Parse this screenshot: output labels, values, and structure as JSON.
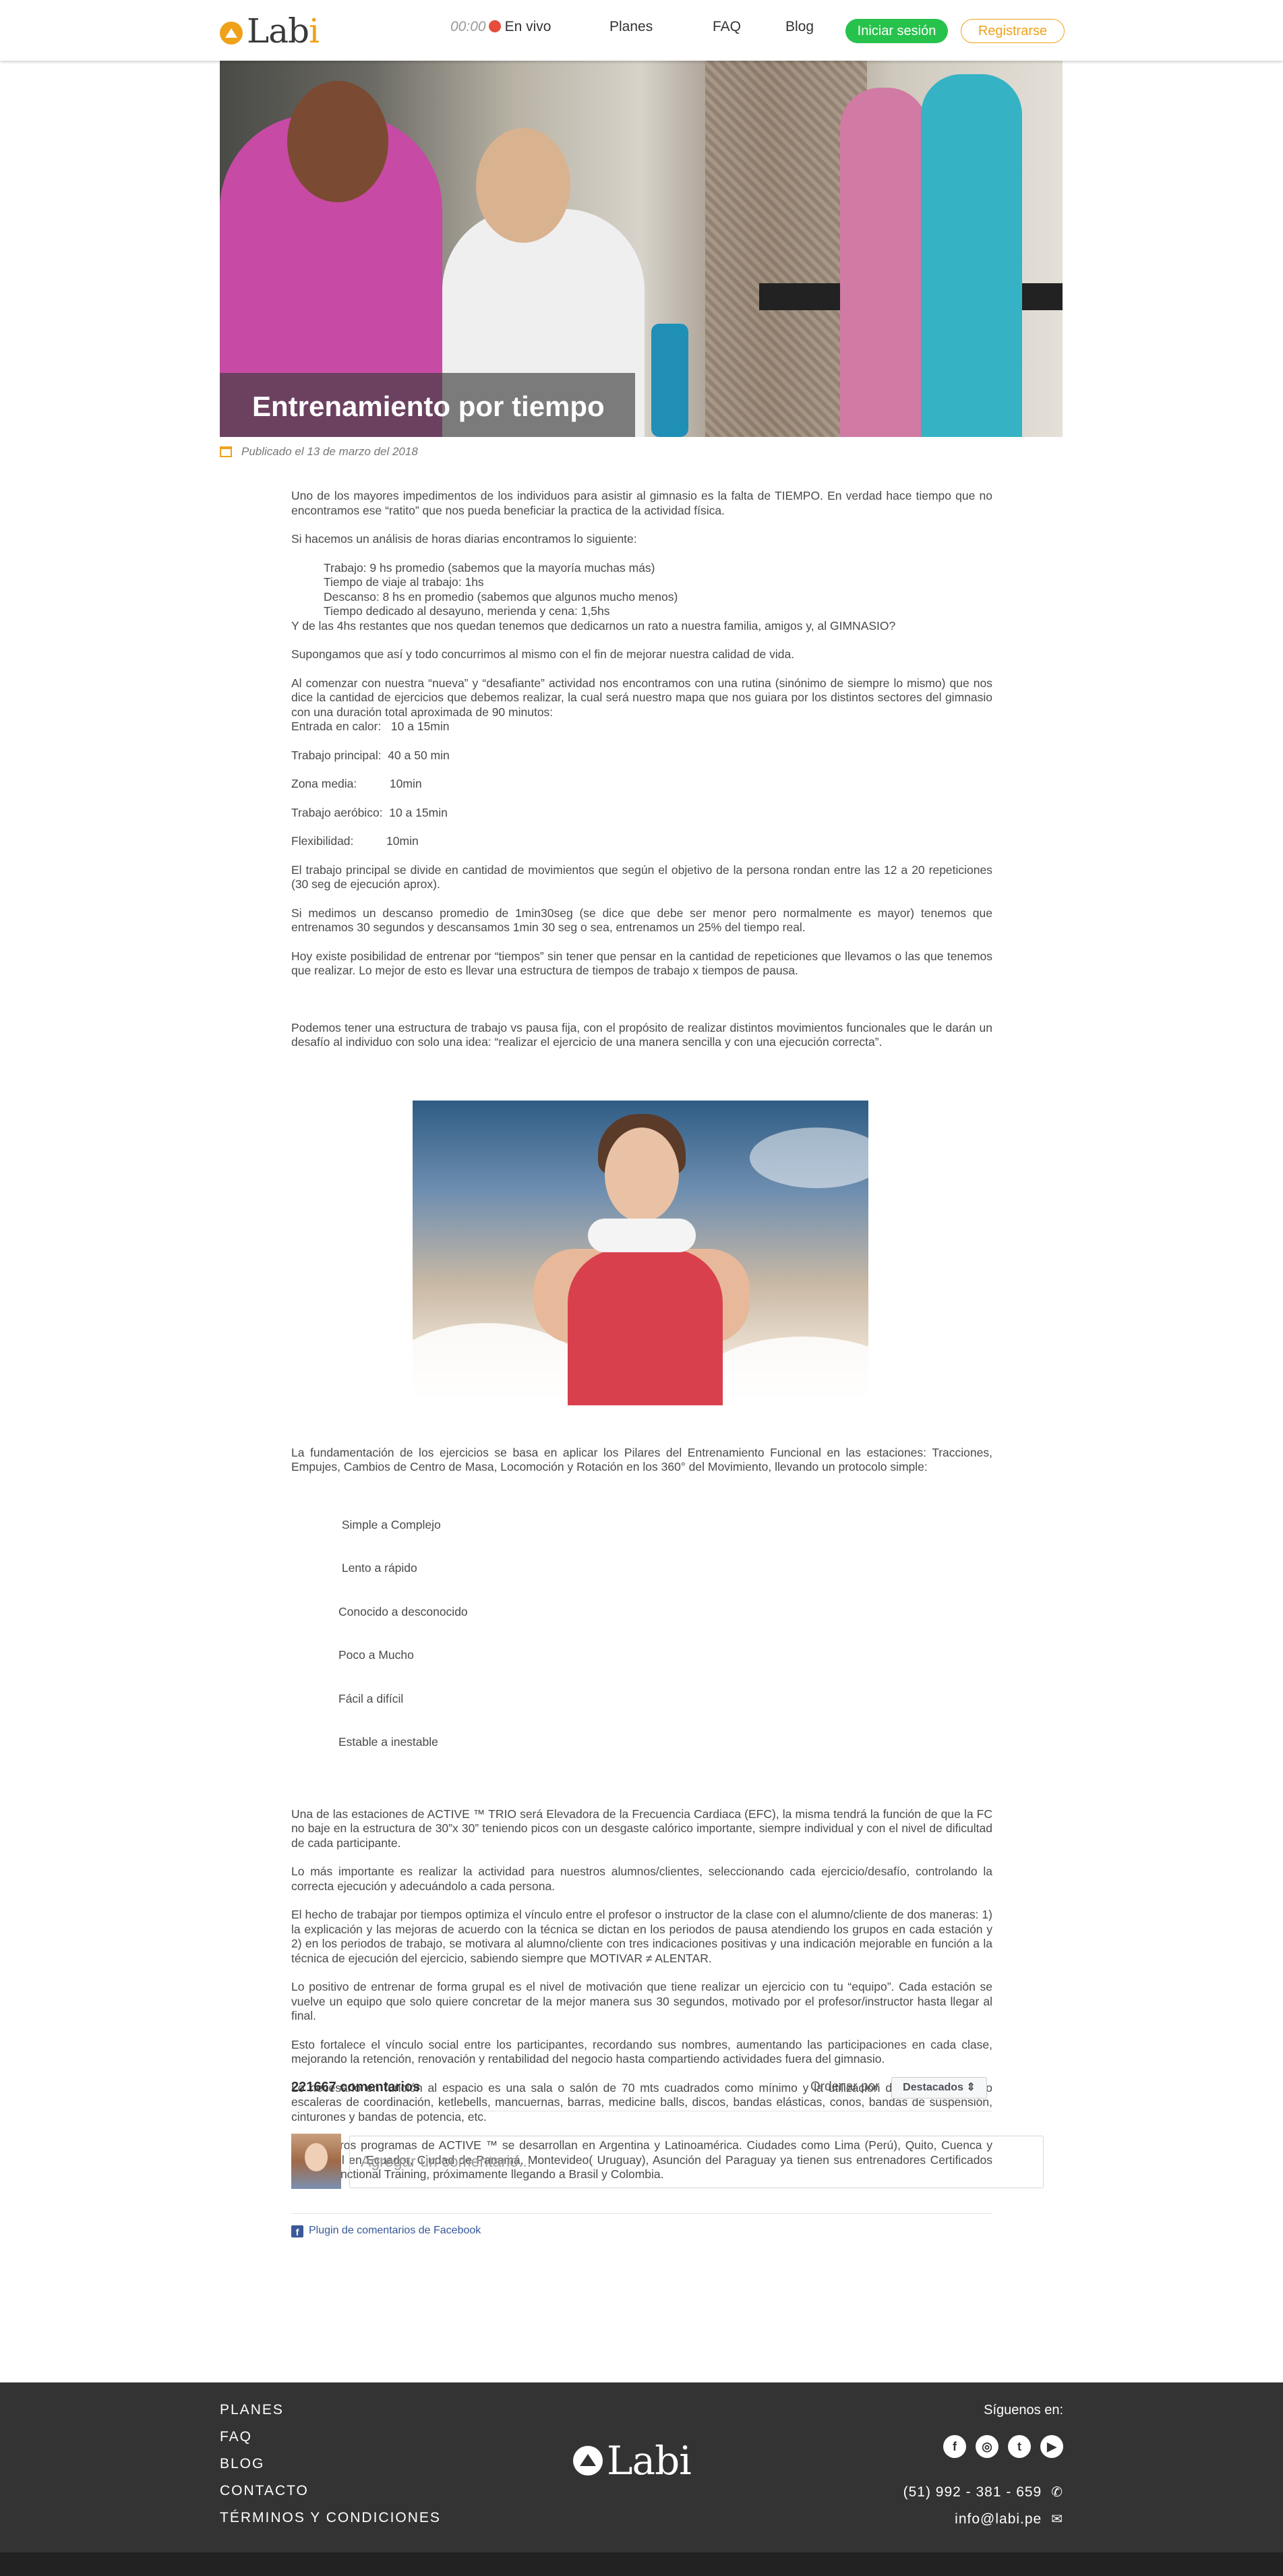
{
  "header": {
    "logo": {
      "main": "Lab",
      "accent": "i"
    },
    "live_time": "00:00",
    "live_label": "En vivo",
    "nav": [
      "Planes",
      "FAQ",
      "Blog"
    ],
    "login": "Iniciar sesión",
    "register": "Registrarse"
  },
  "hero": {
    "title": "Entrenamiento por tiempo"
  },
  "published": "Publicado el 13 de marzo del 2018",
  "article": {
    "p1": "Uno de los mayores impedimentos de los individuos para asistir al gimnasio es la falta de TIEMPO. En verdad hace tiempo que no encontramos ese “ratito” que nos pueda beneficiar la practica de la actividad física.",
    "p2": "Si hacemos un análisis de horas diarias encontramos lo siguiente:",
    "hours": [
      "Trabajo: 9 hs promedio (sabemos que la mayoría muchas más)",
      "Tiempo de viaje al trabajo: 1hs",
      "Descanso: 8 hs en promedio (sabemos que algunos mucho menos)",
      "Tiempo dedicado  al desayuno, merienda y cena: 1,5hs"
    ],
    "p3": "Y de las 4hs restantes que nos quedan tenemos que dedicarnos un rato a nuestra familia, amigos y, al GIMNASIO?",
    "p4": "Supongamos que así y todo concurrimos al mismo con el fin de mejorar nuestra calidad de vida.",
    "p5": "Al comenzar con nuestra “nueva” y “desafiante” actividad nos encontramos con una rutina (sinónimo de siempre lo mismo)  que nos dice la cantidad de ejercicios que debemos realizar, la cual será nuestro mapa que nos guiara por  los distintos sectores del gimnasio con una duración total  aproximada de 90 minutos:",
    "durations": [
      "Entrada en calor:   10 a 15min",
      "Trabajo principal:  40 a 50 min",
      "Zona media:          10min",
      "Trabajo aeróbico:  10 a 15min",
      "Flexibilidad:          10min"
    ],
    "p6": "El trabajo principal se divide en cantidad de movimientos que según el objetivo de la persona rondan entre las 12 a 20 repeticiones (30 seg de ejecución aprox).",
    "p7": "Si medimos un descanso promedio de 1min30seg (se dice que debe ser menor pero normalmente es mayor) tenemos que entrenamos 30 segundos y descansamos 1min 30 seg o sea, entrenamos un 25% del tiempo real.",
    "p8": "Hoy existe  posibilidad de entrenar por “tiempos” sin tener que pensar en la cantidad de repeticiones que llevamos o las que tenemos que realizar. Lo mejor de esto es llevar una estructura de tiempos de trabajo x tiempos de pausa.",
    "p9": "Podemos tener una estructura de trabajo vs pausa fija, con el propósito de realizar distintos movimientos funcionales que le darán un desafío al individuo con solo una idea: “realizar el ejercicio de una manera sencilla y con una ejecución correcta”.",
    "p10": "La fundamentación de los ejercicios se basa en aplicar los Pilares del Entrenamiento Funcional en las estaciones: Tracciones, Empujes, Cambios de Centro de Masa, Locomoción y Rotación en los 360° del Movimiento, llevando un protocolo simple:",
    "protocol": [
      " Simple a Complejo",
      " Lento a rápido",
      "Conocido a desconocido",
      "Poco a Mucho",
      "Fácil a difícil",
      "Estable a inestable"
    ],
    "p11": "Una de las estaciones de ACTIVE ™ TRIO será Elevadora de la Frecuencia Cardiaca (EFC), la misma tendrá la función de que la FC no baje en la estructura de 30”x 30” teniendo picos con un desgaste calórico importante, siempre individual y con el nivel de dificultad de cada participante.",
    "p12": "Lo más importante es realizar la actividad para nuestros alumnos/clientes, seleccionando cada ejercicio/desafío, controlando la correcta ejecución y adecuándolo a cada persona.",
    "p13": "El hecho de trabajar por tiempos optimiza el vínculo entre el profesor o instructor de la clase con el alumno/cliente de dos maneras:  1) la explicación y las mejoras de acuerdo con la técnica se dictan en los periodos de pausa atendiendo los grupos en cada estación y 2) en los periodos de trabajo, se motivara al alumno/cliente con tres indicaciones positivas y una indicación mejorable en función a la técnica de ejecución del ejercicio, sabiendo siempre que MOTIVAR  ≠ ALENTAR.",
    "p14": "Lo positivo de entrenar de forma grupal es el nivel de motivación que tiene realizar un ejercicio con tu “equipo”. Cada estación se vuelve un equipo que solo quiere concretar de la mejor manera sus 30 segundos, motivado por el profesor/instructor hasta llegar al final.",
    "p15": "Esto fortalece el vínculo social entre los participantes, recordando sus nombres, aumentando las participaciones en cada clase, mejorando la retención, renovación y rentabilidad del negocio hasta compartiendo actividades fuera del gimnasio.",
    "p16": "Lo necesario en función al espacio es una sala o salón de 70 mts cuadrados como mínimo y la utilización de materiales como escaleras de coordinación, ketlebells, mancuernas, barras, medicine balls, discos, bandas elásticas, conos, bandas de suspensión, cinturones y bandas de potencia, etc.",
    "p17": "Este y otros programas de ACTIVE ™  se desarrollan en Argentina y Latinoamérica.  Ciudades como Lima (Perú), Quito, Cuenca y Guayaquil en Ecuador, Ciudad de Panamá, Montevideo( Uruguay), Asunción del Paraguay  ya tienen sus entrenadores Certificados Active Functional Training, próximamente llegando a Brasil y Colombia."
  },
  "comments": {
    "count": "221667 comentarios",
    "sort_label": "Ordenar por",
    "sort_value": "Destacados ⇕",
    "placeholder": "Agregar un comentario...",
    "plugin": "Plugin de comentarios de Facebook"
  },
  "footer": {
    "links": [
      "PLANES",
      "FAQ",
      "BLOG",
      "CONTACTO",
      "TÉRMINOS Y CONDICIONES"
    ],
    "logo": "Labi",
    "follow": "Síguenos en:",
    "phone": "(51) 992 - 381 - 659",
    "email": "info@labi.pe"
  }
}
